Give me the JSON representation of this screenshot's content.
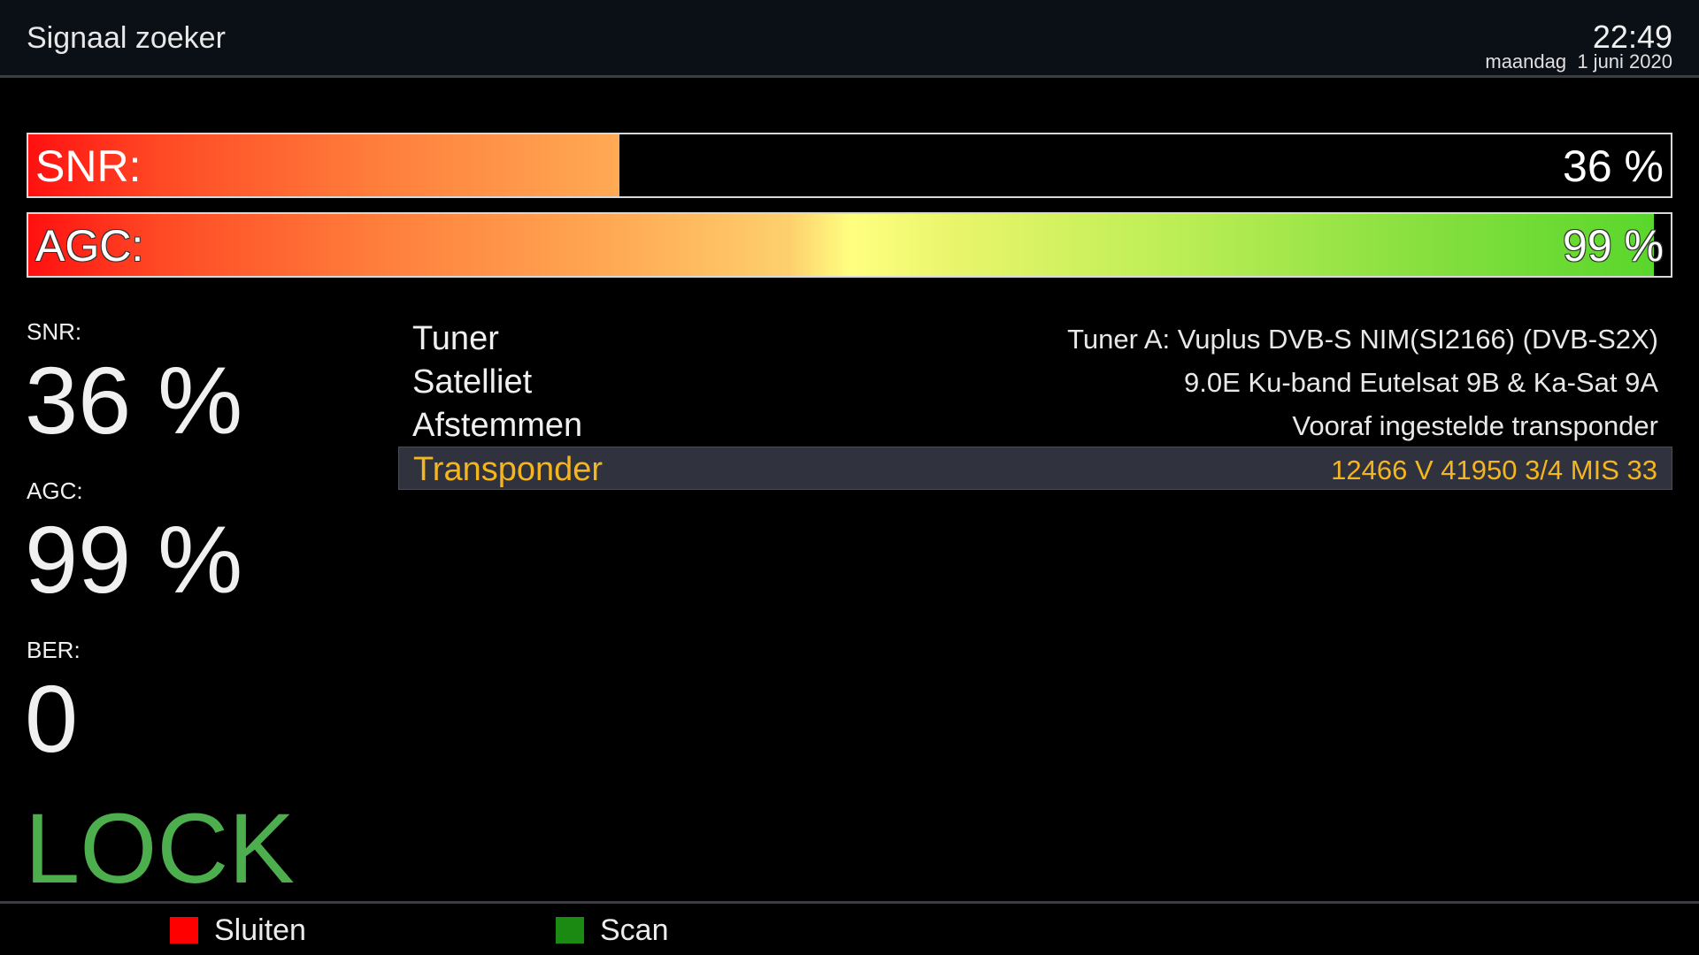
{
  "header": {
    "title": "Signaal zoeker",
    "time": "22:49",
    "date": "maandag  1 juni 2020"
  },
  "bars": {
    "snr": {
      "label": "SNR:",
      "value_text": "36 %",
      "level": 0.36
    },
    "agc": {
      "label": "AGC:",
      "value_text": "99 %",
      "level": 0.99
    }
  },
  "stats": {
    "snr_label": "SNR:",
    "snr_value": "36 %",
    "agc_label": "AGC:",
    "agc_value": "99 %",
    "ber_label": "BER:",
    "ber_value": "0",
    "lock": "LOCK"
  },
  "info": [
    {
      "key": "Tuner",
      "value": "Tuner A: Vuplus DVB-S NIM(SI2166) (DVB-S2X)"
    },
    {
      "key": "Satelliet",
      "value": "9.0E Ku-band Eutelsat 9B & Ka-Sat 9A"
    },
    {
      "key": "Afstemmen",
      "value": "Vooraf ingestelde transponder"
    },
    {
      "key": "Transponder",
      "value": "12466 V 41950 3/4 MIS 33",
      "selected": true
    }
  ],
  "footer": {
    "red_label": "Sluiten",
    "green_label": "Scan"
  },
  "colors": {
    "lock": "#4cae4c",
    "selected_text": "#f4b51e",
    "key_red": "#ff0000",
    "key_green": "#1a8a12"
  }
}
